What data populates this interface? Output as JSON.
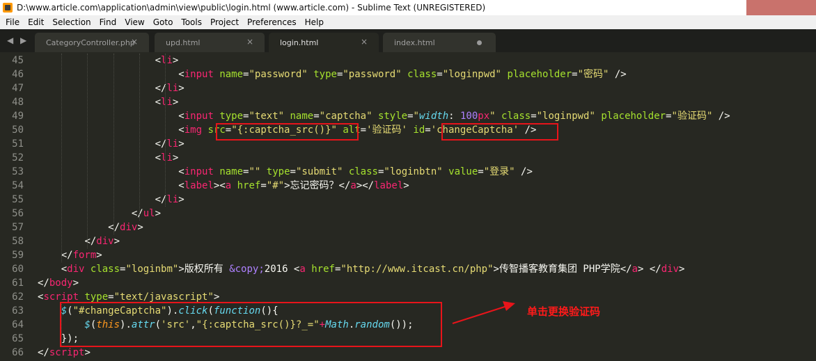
{
  "window": {
    "title": "D:\\www.article.com\\application\\admin\\view\\public\\login.html (www.article.com) - Sublime Text (UNREGISTERED)"
  },
  "menu": [
    "File",
    "Edit",
    "Selection",
    "Find",
    "View",
    "Goto",
    "Tools",
    "Project",
    "Preferences",
    "Help"
  ],
  "tabs": [
    {
      "label": "CategoryController.php",
      "close": "×"
    },
    {
      "label": "upd.html",
      "close": "×"
    },
    {
      "label": "login.html",
      "close": "×"
    },
    {
      "label": "index.html"
    }
  ],
  "nav_arrows": "◀ ▶",
  "colors": {
    "background": "#272822",
    "tag": "#f92672",
    "attribute": "#a6e22e",
    "string": "#e6db74",
    "annotation": "#ff1a1a"
  },
  "code_lines": [
    {
      "n": "45",
      "indent": "                    ",
      "tokens": [
        {
          "t": "<",
          "c": "pn"
        },
        {
          "t": "li",
          "c": "tag"
        },
        {
          "t": ">",
          "c": "pn"
        }
      ]
    },
    {
      "n": "46",
      "indent": "                        ",
      "tokens": [
        {
          "t": "<",
          "c": "pn"
        },
        {
          "t": "input",
          "c": "tag"
        },
        {
          "t": " ",
          "c": "pn"
        },
        {
          "t": "name",
          "c": "attr"
        },
        {
          "t": "=",
          "c": "pn"
        },
        {
          "t": "\"password\"",
          "c": "str"
        },
        {
          "t": " ",
          "c": "pn"
        },
        {
          "t": "type",
          "c": "attr"
        },
        {
          "t": "=",
          "c": "pn"
        },
        {
          "t": "\"password\"",
          "c": "str"
        },
        {
          "t": " ",
          "c": "pn"
        },
        {
          "t": "class",
          "c": "attr"
        },
        {
          "t": "=",
          "c": "pn"
        },
        {
          "t": "\"loginpwd\"",
          "c": "str"
        },
        {
          "t": " ",
          "c": "pn"
        },
        {
          "t": "placeholder",
          "c": "attr"
        },
        {
          "t": "=",
          "c": "pn"
        },
        {
          "t": "\"密码\"",
          "c": "str"
        },
        {
          "t": " />",
          "c": "pn"
        }
      ]
    },
    {
      "n": "47",
      "indent": "                    ",
      "tokens": [
        {
          "t": "</",
          "c": "pn"
        },
        {
          "t": "li",
          "c": "tag"
        },
        {
          "t": ">",
          "c": "pn"
        }
      ]
    },
    {
      "n": "48",
      "indent": "                    ",
      "tokens": [
        {
          "t": "<",
          "c": "pn"
        },
        {
          "t": "li",
          "c": "tag"
        },
        {
          "t": ">",
          "c": "pn"
        }
      ]
    },
    {
      "n": "49",
      "indent": "                        ",
      "tokens": [
        {
          "t": "<",
          "c": "pn"
        },
        {
          "t": "input",
          "c": "tag"
        },
        {
          "t": " ",
          "c": "pn"
        },
        {
          "t": "type",
          "c": "attr"
        },
        {
          "t": "=",
          "c": "pn"
        },
        {
          "t": "\"text\"",
          "c": "str"
        },
        {
          "t": " ",
          "c": "pn"
        },
        {
          "t": "name",
          "c": "attr"
        },
        {
          "t": "=",
          "c": "pn"
        },
        {
          "t": "\"captcha\"",
          "c": "str"
        },
        {
          "t": " ",
          "c": "pn"
        },
        {
          "t": "style",
          "c": "attr"
        },
        {
          "t": "=",
          "c": "pn"
        },
        {
          "t": "\"",
          "c": "str"
        },
        {
          "t": "width",
          "c": "prop"
        },
        {
          "t": ": ",
          "c": "pn"
        },
        {
          "t": "100",
          "c": "num"
        },
        {
          "t": "px",
          "c": "tag"
        },
        {
          "t": "\"",
          "c": "str"
        },
        {
          "t": " ",
          "c": "pn"
        },
        {
          "t": "class",
          "c": "attr"
        },
        {
          "t": "=",
          "c": "pn"
        },
        {
          "t": "\"loginpwd\"",
          "c": "str"
        },
        {
          "t": " ",
          "c": "pn"
        },
        {
          "t": "placeholder",
          "c": "attr"
        },
        {
          "t": "=",
          "c": "pn"
        },
        {
          "t": "\"验证码\"",
          "c": "str"
        },
        {
          "t": " />",
          "c": "pn"
        }
      ]
    },
    {
      "n": "50",
      "indent": "                        ",
      "tokens": [
        {
          "t": "<",
          "c": "pn"
        },
        {
          "t": "img",
          "c": "tag"
        },
        {
          "t": " ",
          "c": "pn"
        },
        {
          "t": "src",
          "c": "attr"
        },
        {
          "t": "=",
          "c": "pn"
        },
        {
          "t": "\"{:captcha_src()}\"",
          "c": "str"
        },
        {
          "t": " ",
          "c": "pn"
        },
        {
          "t": "alt",
          "c": "attr"
        },
        {
          "t": "=",
          "c": "pn"
        },
        {
          "t": "'验证码'",
          "c": "str"
        },
        {
          "t": " ",
          "c": "pn"
        },
        {
          "t": "id",
          "c": "attr"
        },
        {
          "t": "=",
          "c": "pn"
        },
        {
          "t": "'changeCaptcha'",
          "c": "str"
        },
        {
          "t": " />",
          "c": "pn"
        }
      ]
    },
    {
      "n": "51",
      "indent": "                    ",
      "tokens": [
        {
          "t": "</",
          "c": "pn"
        },
        {
          "t": "li",
          "c": "tag"
        },
        {
          "t": ">",
          "c": "pn"
        }
      ]
    },
    {
      "n": "52",
      "indent": "                    ",
      "tokens": [
        {
          "t": "<",
          "c": "pn"
        },
        {
          "t": "li",
          "c": "tag"
        },
        {
          "t": ">",
          "c": "pn"
        }
      ]
    },
    {
      "n": "53",
      "indent": "                        ",
      "tokens": [
        {
          "t": "<",
          "c": "pn"
        },
        {
          "t": "input",
          "c": "tag"
        },
        {
          "t": " ",
          "c": "pn"
        },
        {
          "t": "name",
          "c": "attr"
        },
        {
          "t": "=",
          "c": "pn"
        },
        {
          "t": "\"\"",
          "c": "str"
        },
        {
          "t": " ",
          "c": "pn"
        },
        {
          "t": "type",
          "c": "attr"
        },
        {
          "t": "=",
          "c": "pn"
        },
        {
          "t": "\"submit\"",
          "c": "str"
        },
        {
          "t": " ",
          "c": "pn"
        },
        {
          "t": "class",
          "c": "attr"
        },
        {
          "t": "=",
          "c": "pn"
        },
        {
          "t": "\"loginbtn\"",
          "c": "str"
        },
        {
          "t": " ",
          "c": "pn"
        },
        {
          "t": "value",
          "c": "attr"
        },
        {
          "t": "=",
          "c": "pn"
        },
        {
          "t": "\"登录\"",
          "c": "str"
        },
        {
          "t": " />",
          "c": "pn"
        }
      ]
    },
    {
      "n": "54",
      "indent": "                        ",
      "tokens": [
        {
          "t": "<",
          "c": "pn"
        },
        {
          "t": "label",
          "c": "tag"
        },
        {
          "t": "><",
          "c": "pn"
        },
        {
          "t": "a",
          "c": "tag"
        },
        {
          "t": " ",
          "c": "pn"
        },
        {
          "t": "href",
          "c": "attr"
        },
        {
          "t": "=",
          "c": "pn"
        },
        {
          "t": "\"#\"",
          "c": "str"
        },
        {
          "t": ">忘记密码？</",
          "c": "pn"
        },
        {
          "t": "a",
          "c": "tag"
        },
        {
          "t": "></",
          "c": "pn"
        },
        {
          "t": "label",
          "c": "tag"
        },
        {
          "t": ">",
          "c": "pn"
        }
      ]
    },
    {
      "n": "55",
      "indent": "                    ",
      "tokens": [
        {
          "t": "</",
          "c": "pn"
        },
        {
          "t": "li",
          "c": "tag"
        },
        {
          "t": ">",
          "c": "pn"
        }
      ]
    },
    {
      "n": "56",
      "indent": "                ",
      "tokens": [
        {
          "t": "</",
          "c": "pn"
        },
        {
          "t": "ul",
          "c": "tag"
        },
        {
          "t": ">",
          "c": "pn"
        }
      ]
    },
    {
      "n": "57",
      "indent": "            ",
      "tokens": [
        {
          "t": "</",
          "c": "pn"
        },
        {
          "t": "div",
          "c": "tag"
        },
        {
          "t": ">",
          "c": "pn"
        }
      ]
    },
    {
      "n": "58",
      "indent": "        ",
      "tokens": [
        {
          "t": "</",
          "c": "pn"
        },
        {
          "t": "div",
          "c": "tag"
        },
        {
          "t": ">",
          "c": "pn"
        }
      ]
    },
    {
      "n": "59",
      "indent": "    ",
      "tokens": [
        {
          "t": "</",
          "c": "pn"
        },
        {
          "t": "form",
          "c": "tag"
        },
        {
          "t": ">",
          "c": "pn"
        }
      ]
    },
    {
      "n": "60",
      "indent": "    ",
      "tokens": [
        {
          "t": "<",
          "c": "pn"
        },
        {
          "t": "div",
          "c": "tag"
        },
        {
          "t": " ",
          "c": "pn"
        },
        {
          "t": "class",
          "c": "attr"
        },
        {
          "t": "=",
          "c": "pn"
        },
        {
          "t": "\"loginbm\"",
          "c": "str"
        },
        {
          "t": ">版权所有 ",
          "c": "pn"
        },
        {
          "t": "&copy;",
          "c": "ent"
        },
        {
          "t": "2016 <",
          "c": "pn"
        },
        {
          "t": "a",
          "c": "tag"
        },
        {
          "t": " ",
          "c": "pn"
        },
        {
          "t": "href",
          "c": "attr"
        },
        {
          "t": "=",
          "c": "pn"
        },
        {
          "t": "\"http://www.itcast.cn/php\"",
          "c": "str"
        },
        {
          "t": ">传智播客教育集团 PHP学院</",
          "c": "pn"
        },
        {
          "t": "a",
          "c": "tag"
        },
        {
          "t": "> </",
          "c": "pn"
        },
        {
          "t": "div",
          "c": "tag"
        },
        {
          "t": ">",
          "c": "pn"
        }
      ]
    },
    {
      "n": "61",
      "indent": "",
      "tokens": [
        {
          "t": "</",
          "c": "pn"
        },
        {
          "t": "body",
          "c": "tag"
        },
        {
          "t": ">",
          "c": "pn"
        }
      ]
    },
    {
      "n": "62",
      "indent": "",
      "tokens": [
        {
          "t": "<",
          "c": "pn"
        },
        {
          "t": "script",
          "c": "tag"
        },
        {
          "t": " ",
          "c": "pn"
        },
        {
          "t": "type",
          "c": "attr"
        },
        {
          "t": "=",
          "c": "pn"
        },
        {
          "t": "\"text/javascript\"",
          "c": "str"
        },
        {
          "t": ">",
          "c": "pn"
        }
      ]
    },
    {
      "n": "63",
      "indent": "    ",
      "tokens": [
        {
          "t": "$",
          "c": "fn"
        },
        {
          "t": "(",
          "c": "pn"
        },
        {
          "t": "\"#changeCaptcha\"",
          "c": "str"
        },
        {
          "t": ").",
          "c": "pn"
        },
        {
          "t": "click",
          "c": "fn"
        },
        {
          "t": "(",
          "c": "pn"
        },
        {
          "t": "function",
          "c": "fn"
        },
        {
          "t": "(){",
          "c": "pn"
        }
      ]
    },
    {
      "n": "64",
      "indent": "        ",
      "tokens": [
        {
          "t": "$",
          "c": "fn"
        },
        {
          "t": "(",
          "c": "pn"
        },
        {
          "t": "this",
          "c": "kw"
        },
        {
          "t": ").",
          "c": "pn"
        },
        {
          "t": "attr",
          "c": "fn"
        },
        {
          "t": "(",
          "c": "pn"
        },
        {
          "t": "'src'",
          "c": "str"
        },
        {
          "t": ",",
          "c": "pn"
        },
        {
          "t": "\"{:captcha_src()}?_=\"",
          "c": "str"
        },
        {
          "t": "+",
          "c": "op"
        },
        {
          "t": "Math",
          "c": "fn"
        },
        {
          "t": ".",
          "c": "pn"
        },
        {
          "t": "random",
          "c": "fn"
        },
        {
          "t": "());",
          "c": "pn"
        }
      ]
    },
    {
      "n": "65",
      "indent": "    ",
      "tokens": [
        {
          "t": "});",
          "c": "pn"
        }
      ]
    },
    {
      "n": "66",
      "indent": "",
      "tokens": [
        {
          "t": "</",
          "c": "pn"
        },
        {
          "t": "script",
          "c": "tag"
        },
        {
          "t": ">",
          "c": "pn"
        }
      ]
    }
  ],
  "annotation": {
    "text": "单击更换验证码"
  }
}
